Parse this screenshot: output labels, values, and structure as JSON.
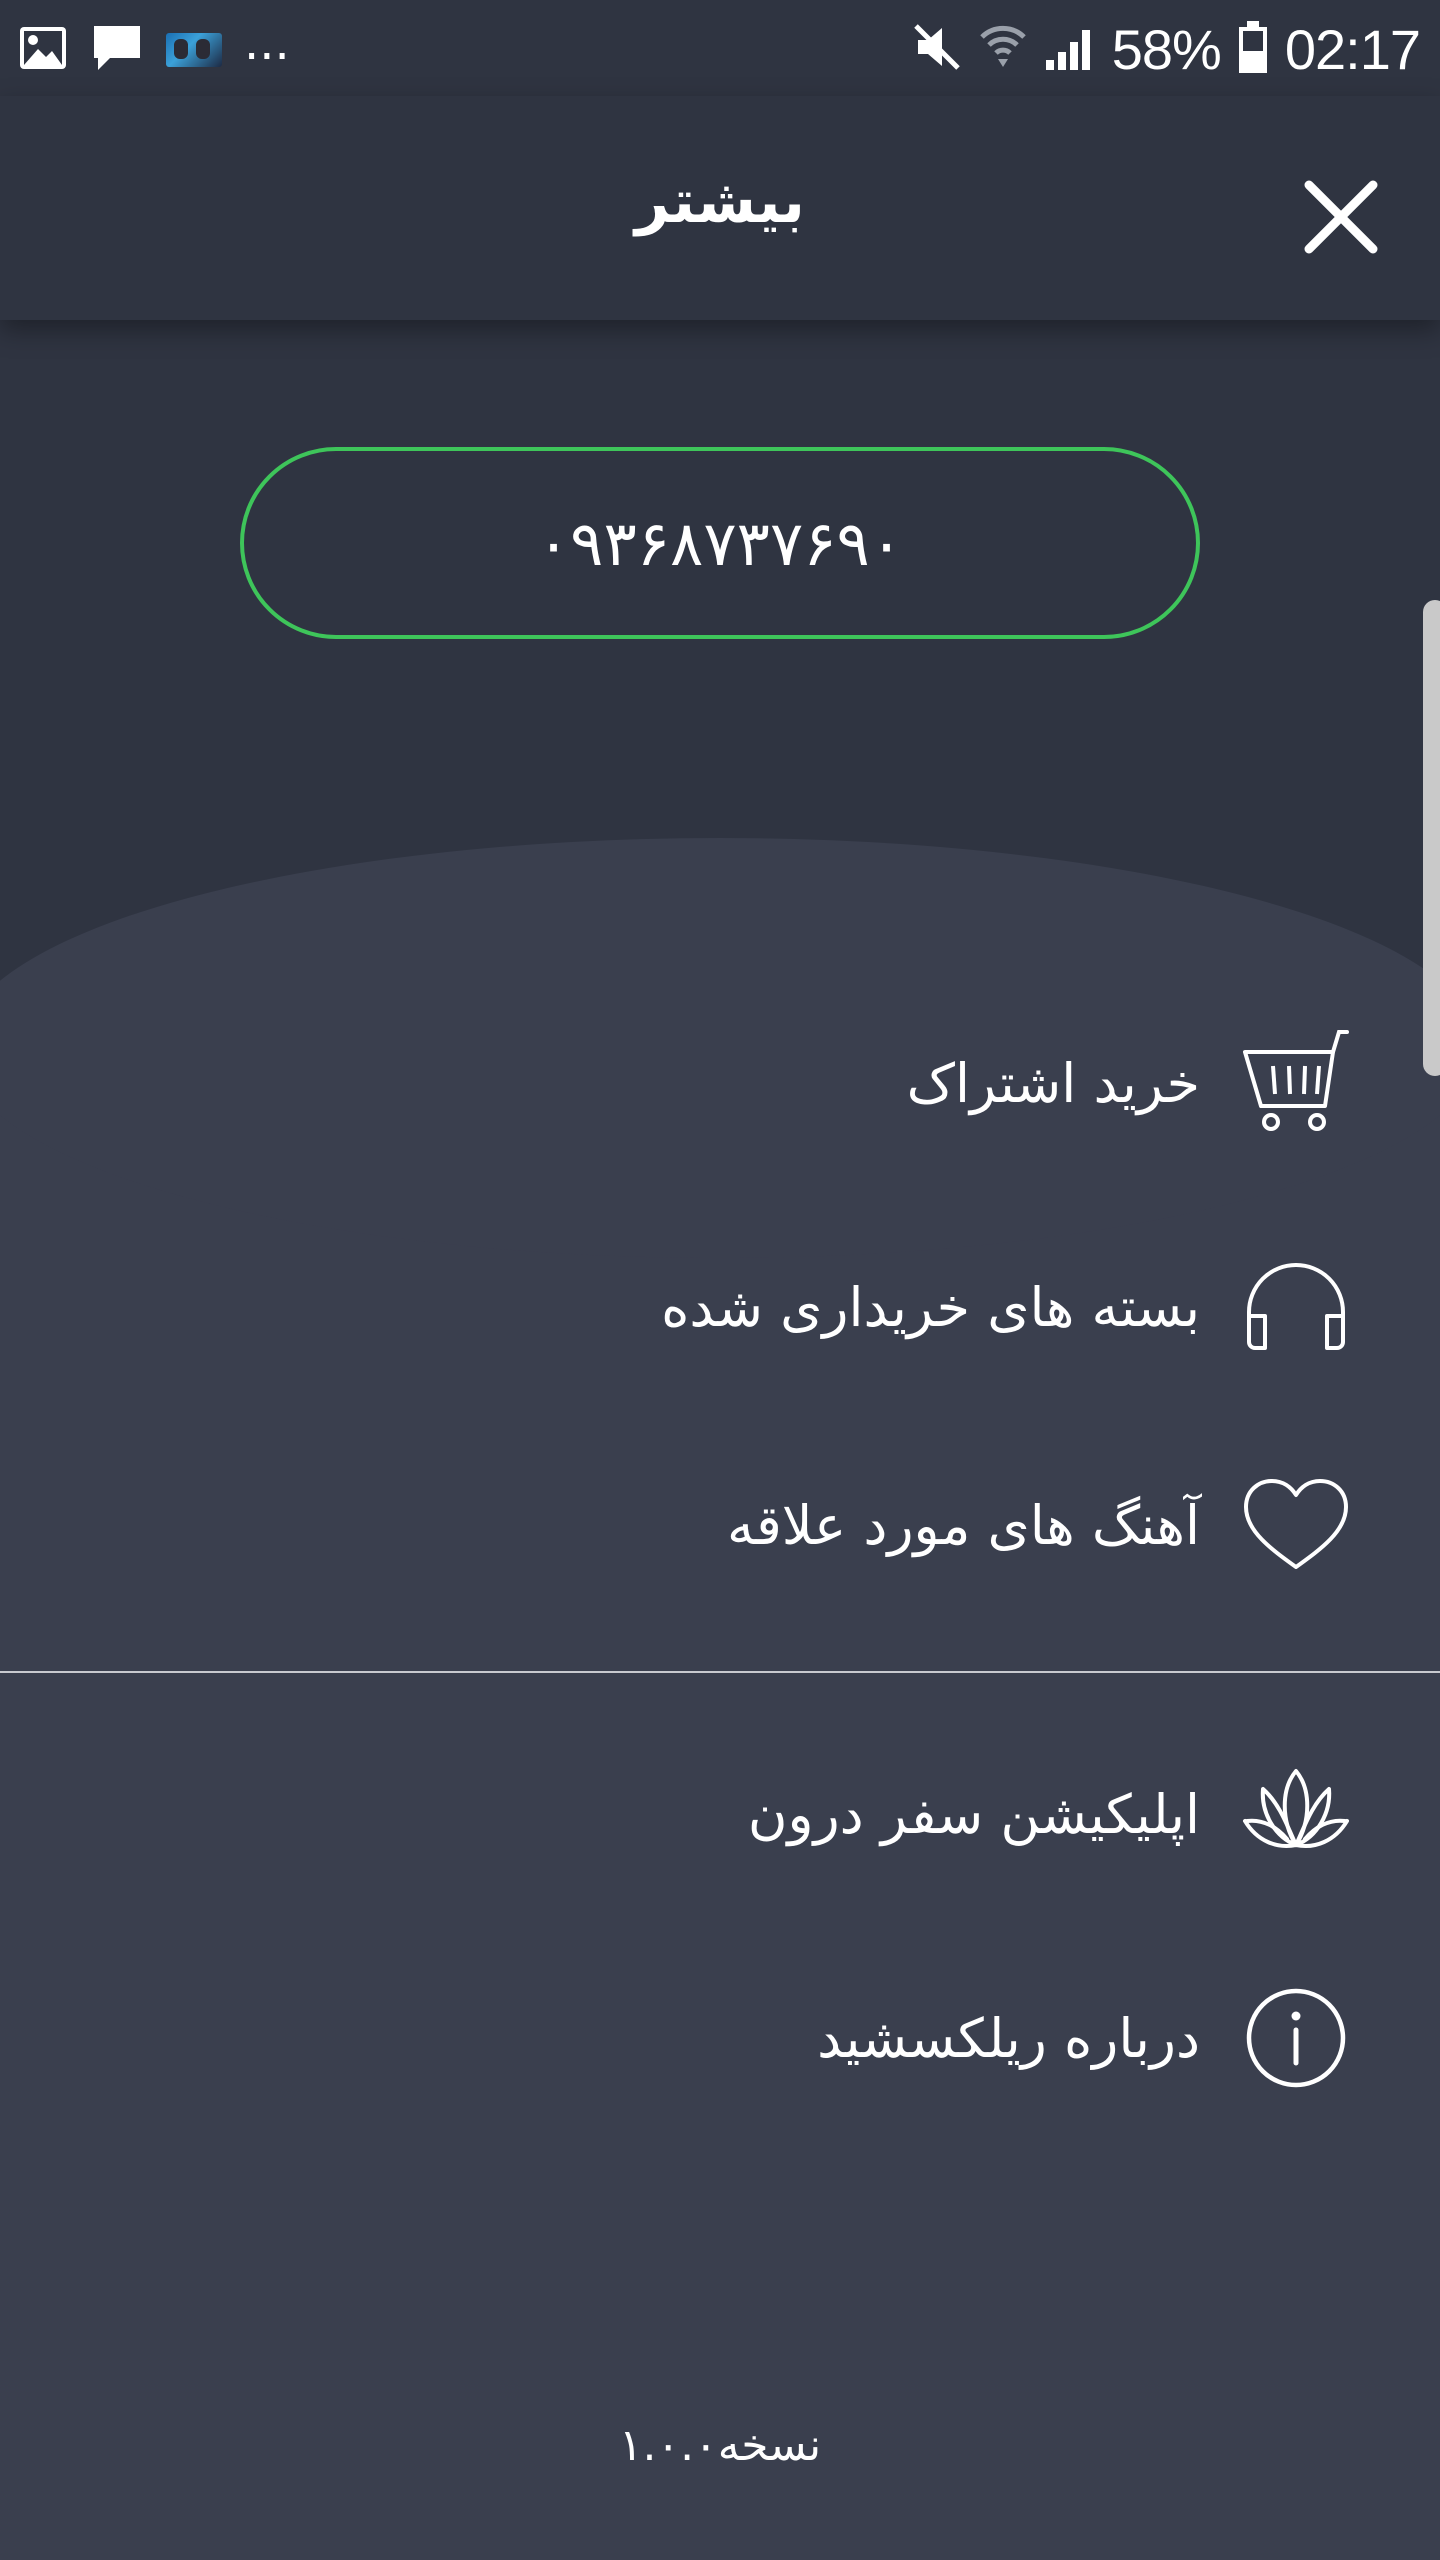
{
  "status_bar": {
    "overflow": "...",
    "battery": "58%",
    "time": "02:17"
  },
  "header": {
    "title": "بیشتر"
  },
  "account": {
    "phone": "۰۹۳۶۸۷۳۷۶۹۰"
  },
  "menu": {
    "items": [
      {
        "label": "خرید اشتراک",
        "icon": "cart-icon"
      },
      {
        "label": "بسته های خریداری شده",
        "icon": "headphones-icon"
      },
      {
        "label": "آهنگ های مورد علاقه",
        "icon": "heart-icon"
      },
      {
        "label": "اپلیکیشن سفر درون",
        "icon": "lotus-icon"
      },
      {
        "label": "درباره ریلکسشید",
        "icon": "info-icon"
      }
    ]
  },
  "footer": {
    "version": "نسخه۱.۰.۰"
  },
  "colors": {
    "background": "#3a3f4e",
    "header": "#2f3441",
    "accent_green": "#3ec55a"
  }
}
